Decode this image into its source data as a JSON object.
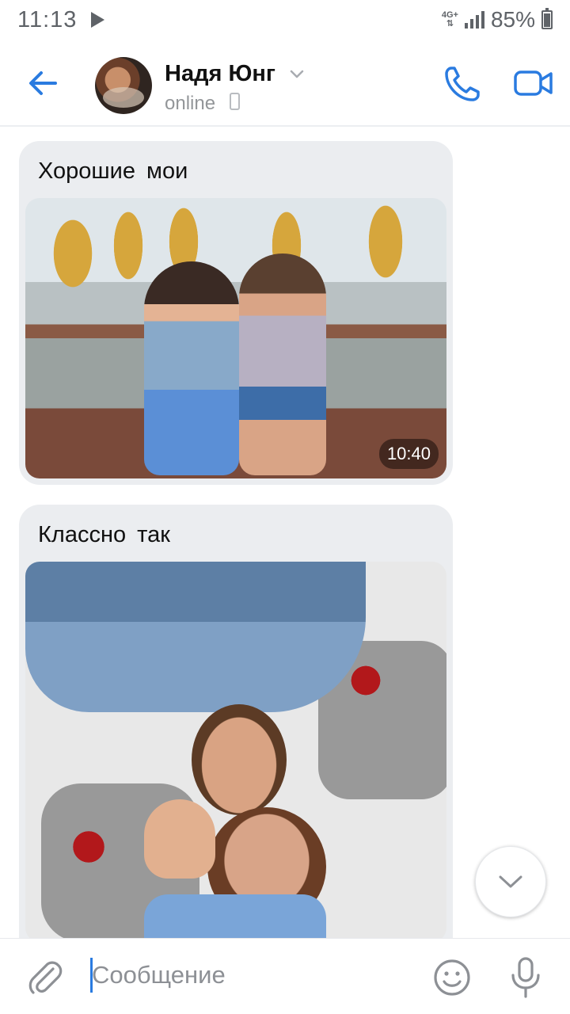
{
  "status_bar": {
    "time": "11:13",
    "network_type": "4G+",
    "battery_percent": "85%",
    "battery_level": 0.85
  },
  "header": {
    "contact_name": "Надя Юнг",
    "contact_status": "online"
  },
  "messages": [
    {
      "text": "Хорошие  мои",
      "photo_time": "10:40"
    },
    {
      "text": "Классно  так"
    }
  ],
  "composer": {
    "placeholder": "Сообщение"
  },
  "colors": {
    "accent": "#2a7be0",
    "bubble_bg": "#ebedf0",
    "icon_gray": "#8d9095"
  },
  "icons": {
    "back": "arrow-left-icon",
    "call": "phone-icon",
    "video": "video-camera-icon",
    "attach": "paperclip-icon",
    "emoji": "smiley-icon",
    "mic": "microphone-icon",
    "scroll": "chevron-down-icon"
  }
}
